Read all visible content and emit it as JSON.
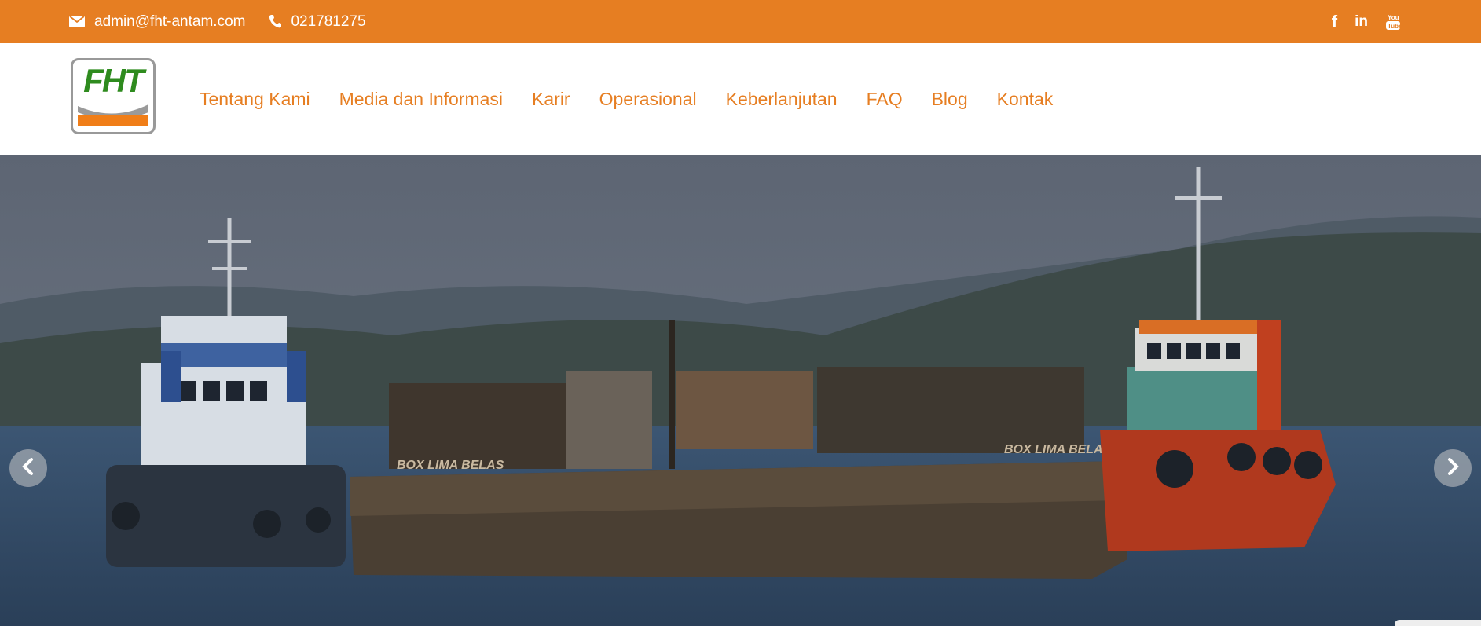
{
  "topbar": {
    "email": "admin@fht-antam.com",
    "phone": "021781275",
    "social": [
      "facebook-icon",
      "linkedin-icon",
      "youtube-icon"
    ],
    "bg_color": "#e67e22"
  },
  "header": {
    "logo_text": "FHT",
    "nav": [
      "Tentang Kami",
      "Media dan Informasi",
      "Karir",
      "Operasional",
      "Keberlanjutan",
      "FAQ",
      "Blog",
      "Kontak"
    ],
    "accent_color": "#e67e22"
  },
  "hero": {
    "description_icons": [
      "chevron-left-icon",
      "chevron-right-icon"
    ],
    "barge_label_left": "BOX LIMA BELAS",
    "barge_label_right": "BOX LIMA BELAS"
  }
}
